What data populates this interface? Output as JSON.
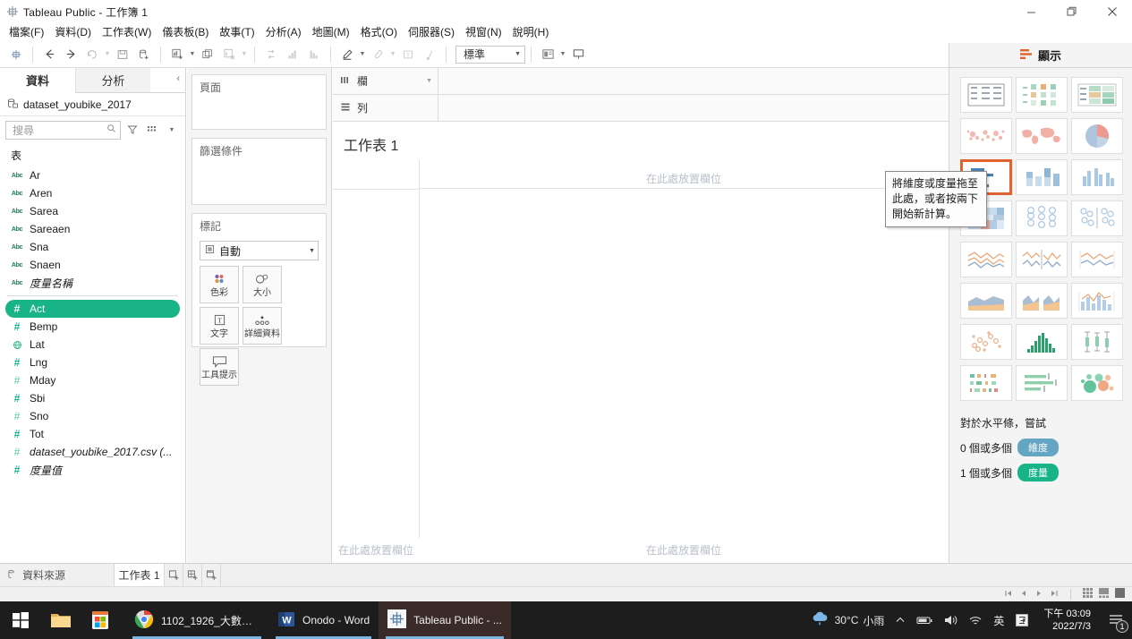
{
  "window": {
    "title": "Tableau Public - 工作簿 1",
    "icon": "tableau-logo-icon",
    "controls": {
      "minimize": "minimize-icon",
      "maximize": "maximize-icon",
      "close": "close-icon"
    }
  },
  "menubar": {
    "items": [
      {
        "label": "檔案(F)"
      },
      {
        "label": "資料(D)"
      },
      {
        "label": "工作表(W)"
      },
      {
        "label": "儀表板(B)"
      },
      {
        "label": "故事(T)"
      },
      {
        "label": "分析(A)"
      },
      {
        "label": "地圖(M)"
      },
      {
        "label": "格式(O)"
      },
      {
        "label": "伺服器(S)"
      },
      {
        "label": "視窗(N)"
      },
      {
        "label": "說明(H)"
      }
    ]
  },
  "toolbar": {
    "fit_value": "標準",
    "buttons": [
      {
        "name": "tableau-home-icon"
      },
      {
        "name": "back-icon"
      },
      {
        "name": "forward-icon"
      },
      {
        "name": "refresh-icon"
      },
      {
        "name": "save-icon"
      },
      {
        "name": "add-data-source-icon"
      },
      {
        "name": "new-worksheet-icon"
      },
      {
        "name": "duplicate-sheet-icon"
      },
      {
        "name": "clear-sheet-icon"
      },
      {
        "name": "swap-rows-columns-icon"
      },
      {
        "name": "sort-ascending-icon"
      },
      {
        "name": "sort-descending-icon"
      },
      {
        "name": "highlight-icon"
      },
      {
        "name": "grouping-icon"
      },
      {
        "name": "labels-icon"
      },
      {
        "name": "fix-axes-icon"
      },
      {
        "name": "presentation-mode-icon"
      },
      {
        "name": "show-me-toggle-icon"
      }
    ]
  },
  "data_pane": {
    "tabs": [
      {
        "label": "資料",
        "active": true
      },
      {
        "label": "分析",
        "active": false
      }
    ],
    "collapse_icon": "chevron-left-icon",
    "datasource": {
      "label": "dataset_youbike_2017",
      "icon": "datasource-icon"
    },
    "search": {
      "placeholder": "搜尋",
      "icon": "search-icon"
    },
    "search_tools": [
      {
        "name": "filter-icon"
      },
      {
        "name": "group-by-icon"
      },
      {
        "name": "chevron-down-icon"
      }
    ],
    "group_header": "表",
    "fields": [
      {
        "name": "Ar",
        "type": "abc",
        "italic": false,
        "selected": false
      },
      {
        "name": "Aren",
        "type": "abc",
        "italic": false,
        "selected": false
      },
      {
        "name": "Sarea",
        "type": "abc",
        "italic": false,
        "selected": false
      },
      {
        "name": "Sareaen",
        "type": "abc",
        "italic": false,
        "selected": false
      },
      {
        "name": "Sna",
        "type": "abc",
        "italic": false,
        "selected": false
      },
      {
        "name": "Snaen",
        "type": "abc",
        "italic": false,
        "selected": false
      },
      {
        "name": "度量名稱",
        "type": "abc",
        "italic": true,
        "selected": false
      },
      {
        "name": "Act",
        "type": "hash",
        "italic": false,
        "selected": true
      },
      {
        "name": "Bemp",
        "type": "hash",
        "italic": false,
        "selected": false
      },
      {
        "name": "Lat",
        "type": "geo",
        "italic": false,
        "selected": false
      },
      {
        "name": "Lng",
        "type": "hash",
        "italic": false,
        "selected": false
      },
      {
        "name": "Mday",
        "type": "hashlight",
        "italic": false,
        "selected": false
      },
      {
        "name": "Sbi",
        "type": "hash",
        "italic": false,
        "selected": false
      },
      {
        "name": "Sno",
        "type": "hashlight",
        "italic": false,
        "selected": false
      },
      {
        "name": "Tot",
        "type": "hash",
        "italic": false,
        "selected": false
      },
      {
        "name": "dataset_youbike_2017.csv (...",
        "type": "hashlight",
        "italic": true,
        "selected": false
      },
      {
        "name": "度量值",
        "type": "hash",
        "italic": true,
        "selected": false
      }
    ]
  },
  "cards": {
    "pages": {
      "title": "頁面"
    },
    "filters": {
      "title": "篩選條件"
    },
    "marks": {
      "title": "標記",
      "mark_type": "自動",
      "mark_type_icon": "automatic-mark-icon",
      "dropdown_icon": "chevron-down-icon",
      "buttons": [
        {
          "label": "色彩",
          "icon": "color-icon"
        },
        {
          "label": "大小",
          "icon": "size-icon"
        },
        {
          "label": "文字",
          "icon": "text-icon"
        },
        {
          "label": "詳細資料",
          "icon": "detail-icon"
        },
        {
          "label": "工具提示",
          "icon": "tooltip-icon"
        }
      ]
    }
  },
  "sheet": {
    "columns_shelf": {
      "label": "欄",
      "icon": "columns-icon",
      "caret": "chevron-down-icon"
    },
    "rows_shelf": {
      "label": "列",
      "icon": "rows-icon"
    },
    "title": "工作表 1",
    "drop_field_text": "在此處放置欄位",
    "tooltip": "將維度或度量拖至此處，或者按兩下開始新計算。"
  },
  "show_me": {
    "header": "顯示",
    "header_icon": "show-me-icon",
    "charts": [
      {
        "name": "text-table-chart",
        "selected": false
      },
      {
        "name": "heat-map-chart",
        "selected": false
      },
      {
        "name": "highlight-table-chart",
        "selected": false
      },
      {
        "name": "symbol-map-chart",
        "selected": false
      },
      {
        "name": "filled-map-chart",
        "selected": false
      },
      {
        "name": "pie-chart",
        "selected": false
      },
      {
        "name": "horizontal-bar-chart",
        "selected": true
      },
      {
        "name": "stacked-bar-chart",
        "selected": false
      },
      {
        "name": "side-by-side-bar-chart",
        "selected": false
      },
      {
        "name": "treemap-chart",
        "selected": false
      },
      {
        "name": "circle-view-chart",
        "selected": false
      },
      {
        "name": "side-by-side-circle-chart",
        "selected": false
      },
      {
        "name": "line-chart-discrete",
        "selected": false
      },
      {
        "name": "line-chart-continuous",
        "selected": false
      },
      {
        "name": "dual-line-chart",
        "selected": false
      },
      {
        "name": "area-chart-continuous",
        "selected": false
      },
      {
        "name": "area-chart-discrete",
        "selected": false
      },
      {
        "name": "dual-combination-chart",
        "selected": false
      },
      {
        "name": "scatter-plot-chart",
        "selected": false
      },
      {
        "name": "histogram-chart",
        "selected": false
      },
      {
        "name": "box-and-whisker-chart",
        "selected": false
      },
      {
        "name": "gantt-chart",
        "selected": false
      },
      {
        "name": "bullet-chart",
        "selected": false
      },
      {
        "name": "packed-bubbles-chart",
        "selected": false
      }
    ],
    "footer": {
      "line1": "對於水平條，嘗試",
      "rows": [
        {
          "prefix": "0 個或多個",
          "pill": "維度",
          "pill_color": "#64a5c4"
        },
        {
          "prefix": "1 個或多個",
          "pill": "度量",
          "pill_color": "#18b387"
        }
      ]
    }
  },
  "bottom_bar": {
    "datasource_tab": {
      "label": "資料來源",
      "icon": "datasource-small-icon"
    },
    "sheet_tabs": [
      {
        "label": "工作表 1",
        "active": true
      }
    ],
    "new_buttons": [
      {
        "name": "new-worksheet-tab-icon"
      },
      {
        "name": "new-dashboard-tab-icon"
      },
      {
        "name": "new-story-tab-icon"
      }
    ]
  },
  "status_bar": {
    "nav": [
      {
        "name": "first-page-icon"
      },
      {
        "name": "previous-page-icon"
      },
      {
        "name": "next-page-icon"
      },
      {
        "name": "last-page-icon"
      }
    ],
    "view_modes": [
      {
        "name": "grid-view-icon"
      },
      {
        "name": "filmstrip-view-icon"
      },
      {
        "name": "single-view-icon"
      }
    ]
  },
  "taskbar": {
    "start": {
      "name": "windows-start-icon"
    },
    "pinned": [
      {
        "name": "file-explorer-icon"
      },
      {
        "name": "microsoft-store-icon"
      }
    ],
    "apps": [
      {
        "label": "1102_1926_大數據...",
        "icon": "chrome-icon",
        "active": false
      },
      {
        "label": "Onodo - Word",
        "icon": "word-icon",
        "active": false
      },
      {
        "label": "Tableau Public - ...",
        "icon": "tableau-icon",
        "active": true
      }
    ],
    "tray": {
      "weather": {
        "temperature": "30°C",
        "condition": "小雨",
        "icon": "rain-cloud-icon"
      },
      "expand_icon": "chevron-up-icon",
      "icons": [
        {
          "name": "battery-icon"
        },
        {
          "name": "volume-icon"
        },
        {
          "name": "wifi-icon"
        }
      ],
      "ime": "英",
      "ime_mode_icon": "ime-mode-icon",
      "time": "下午 03:09",
      "date": "2022/7/3",
      "notifications": {
        "icon": "notification-icon",
        "count": "1"
      }
    }
  }
}
